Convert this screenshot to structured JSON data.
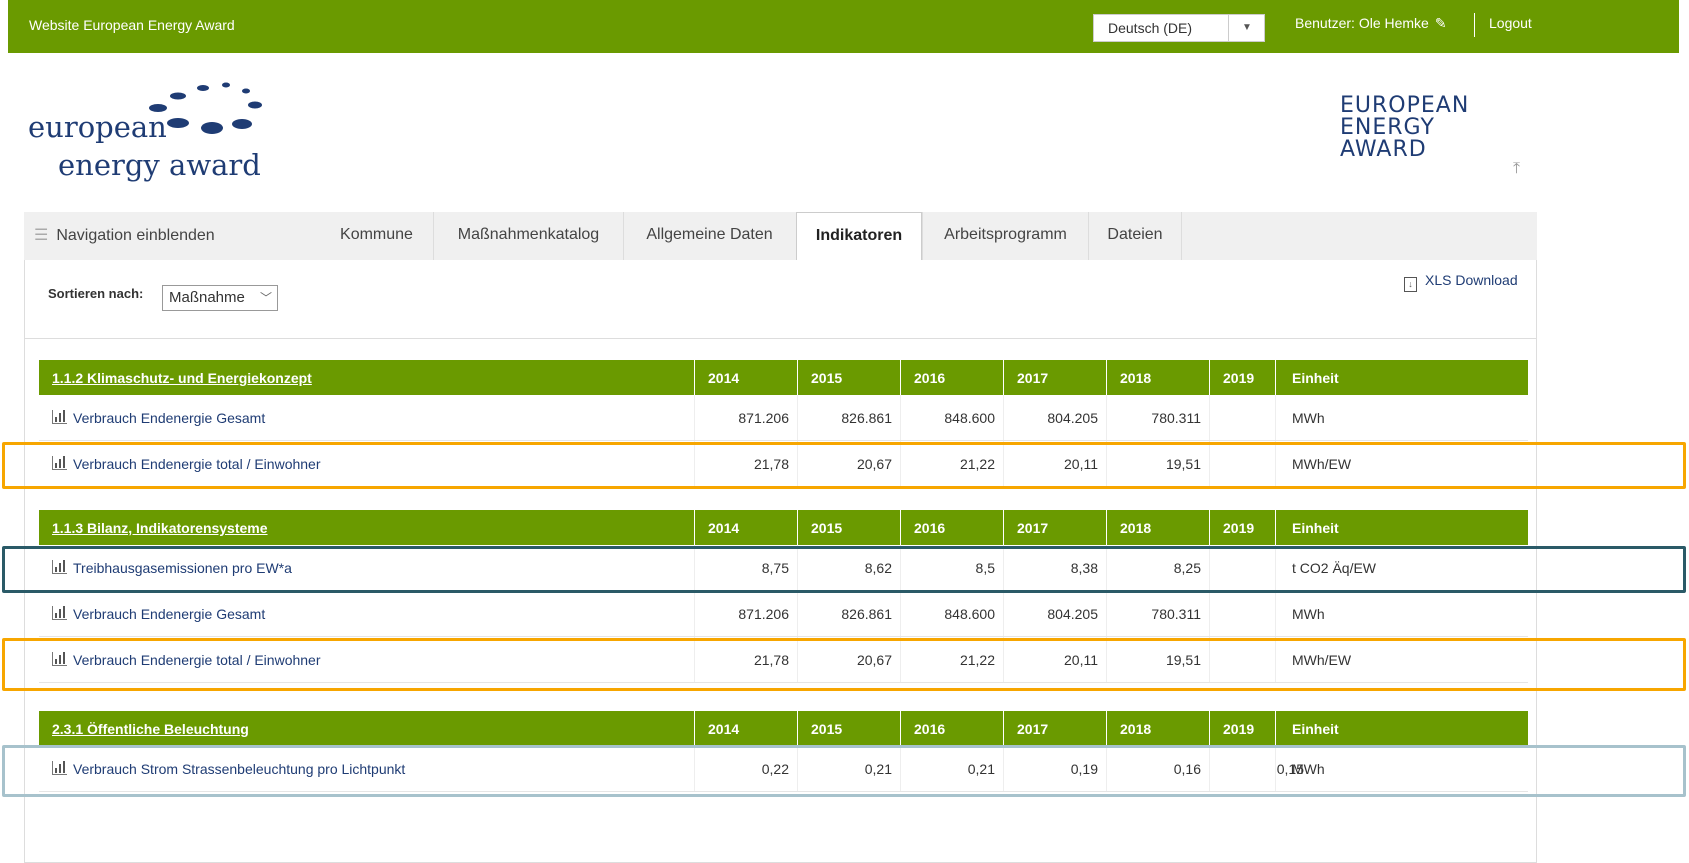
{
  "topbar": {
    "site_title": "Website European Energy Award",
    "language": "Deutsch (DE)",
    "user_label": "Benutzer: Ole Hemke",
    "logout": "Logout"
  },
  "logos": {
    "left_line1": "european",
    "left_line2": "energy award",
    "right_line1": "EUROPEAN",
    "right_line2": "ENERGY",
    "right_line3": "AWARD"
  },
  "nav": {
    "toggle": "Navigation einblenden",
    "tabs": [
      "Kommune",
      "Maßnahmenkatalog",
      "Allgemeine Daten",
      "Indikatoren",
      "Arbeitsprogramm",
      "Dateien"
    ],
    "active_tab": "Indikatoren"
  },
  "toolbar": {
    "sort_label": "Sortieren nach:",
    "sort_value": "Maßnahme",
    "xls_download": "XLS Download"
  },
  "year_headers": [
    "2014",
    "2015",
    "2016",
    "2017",
    "2018",
    "2019"
  ],
  "unit_header": "Einheit",
  "sections": [
    {
      "title": "1.1.2 Klimaschutz- und Energiekonzept",
      "rows": [
        {
          "name": "Verbrauch Endenergie Gesamt",
          "values": [
            "871.206",
            "826.861",
            "848.600",
            "804.205",
            "780.311",
            ""
          ],
          "unit": "MWh"
        },
        {
          "name": "Verbrauch Endenergie total / Einwohner",
          "values": [
            "21,78",
            "20,67",
            "21,22",
            "20,11",
            "19,51",
            ""
          ],
          "unit": "MWh/EW"
        }
      ]
    },
    {
      "title": "1.1.3 Bilanz, Indikatorensysteme",
      "rows": [
        {
          "name": "Treibhausgasemissionen pro EW*a",
          "values": [
            "8,75",
            "8,62",
            "8,5",
            "8,38",
            "8,25",
            ""
          ],
          "unit": "t CO2 Äq/EW"
        },
        {
          "name": "Verbrauch Endenergie Gesamt",
          "values": [
            "871.206",
            "826.861",
            "848.600",
            "804.205",
            "780.311",
            ""
          ],
          "unit": "MWh"
        },
        {
          "name": "Verbrauch Endenergie total / Einwohner",
          "values": [
            "21,78",
            "20,67",
            "21,22",
            "20,11",
            "19,51",
            ""
          ],
          "unit": "MWh/EW"
        }
      ]
    },
    {
      "title": "2.3.1 Öffentliche Beleuchtung",
      "rows": [
        {
          "name": "Verbrauch Strom Strassenbeleuchtung pro Lichtpunkt",
          "values": [
            "0,22",
            "0,21",
            "0,21",
            "0,19",
            "0,16",
            "0,15"
          ],
          "unit": "MWh"
        }
      ]
    }
  ],
  "colors": {
    "brand_green": "#6a9a00",
    "highlight_orange": "#f7a600",
    "highlight_teal": "#2a5a67",
    "highlight_light": "#a7c2cc"
  }
}
